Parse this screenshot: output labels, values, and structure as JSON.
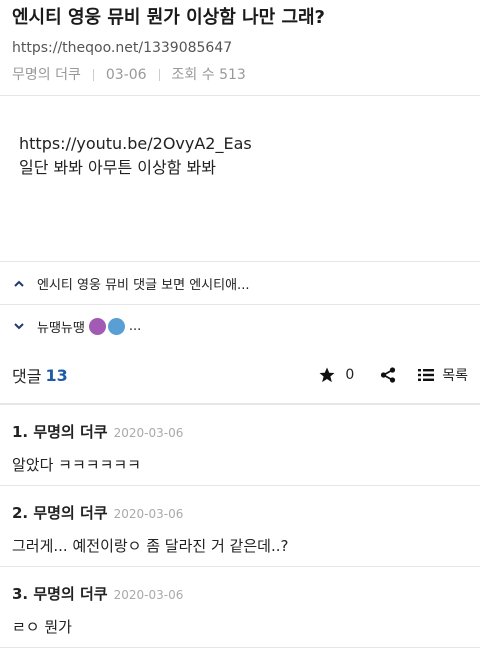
{
  "post": {
    "title": "엔시티 영웅 뮤비 뭔가 이상함 나만 그래?",
    "url": "https://theqoo.net/1339085647",
    "author": "무명의 더쿠",
    "date": "03-06",
    "views": "조회 수 513"
  },
  "content": {
    "line1": "https://youtu.be/2OvyA2_Eas",
    "line2": "일단 봐봐 아무튼 이상함 봐봐"
  },
  "nav": {
    "prev_title": "엔시티 영웅 뮤비 댓글 보면 엔시티애...",
    "next_title": "뉴땡뉴땡",
    "next_suffix": "..."
  },
  "comments_bar": {
    "label": "댓글",
    "count": "13",
    "star_count": "0",
    "list_label": "목록"
  },
  "comments": [
    {
      "author": "1. 무명의 더쿠",
      "date": "2020-03-06",
      "text": "알았다 ㅋㅋㅋㅋㅋㅋ"
    },
    {
      "author": "2. 무명의 더쿠",
      "date": "2020-03-06",
      "text": "그러게... 예전이랑ㅇ 좀 달라진 거 같은데..?"
    },
    {
      "author": "3. 무명의 더쿠",
      "date": "2020-03-06",
      "text": "ㄹㅇ 뭔가"
    }
  ],
  "icons": {
    "up": "chevron-up-icon",
    "down": "chevron-down-icon",
    "star": "star-icon",
    "share": "share-icon",
    "list": "list-icon"
  },
  "colors": {
    "accent": "#1f5aa8",
    "divider": "#e6e6e6",
    "meta": "#999999"
  }
}
